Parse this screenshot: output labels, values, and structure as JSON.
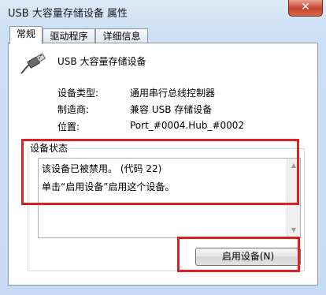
{
  "window": {
    "title": "USB 大容量存储设备 属性",
    "close_label": "✕"
  },
  "tabs": [
    {
      "label": "常规",
      "active": true
    },
    {
      "label": "驱动程序",
      "active": false
    },
    {
      "label": "详细信息",
      "active": false
    }
  ],
  "device": {
    "name": "USB 大容量存储设备",
    "icon": "usb-plug-icon",
    "properties": [
      {
        "label": "设备类型:",
        "value": "通用串行总线控制器"
      },
      {
        "label": "制造商:",
        "value": "兼容 USB 存储设备"
      },
      {
        "label": "位置:",
        "value": "Port_#0004.Hub_#0002"
      }
    ]
  },
  "status": {
    "legend": "设备状态",
    "lines": [
      "该设备已被禁用。 (代码 22)",
      "单击“启用设备”启用这个设备。"
    ]
  },
  "enable_button_label": "启用设备(N)",
  "colors": {
    "highlight": "#e02020",
    "close_button": "#c4432b"
  }
}
